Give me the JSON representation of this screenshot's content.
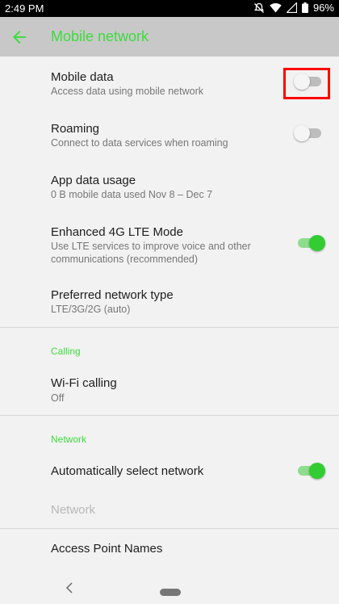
{
  "status_bar": {
    "time": "2:49 PM",
    "battery": "96%"
  },
  "appbar": {
    "title": "Mobile network"
  },
  "items": {
    "mobile_data": {
      "title": "Mobile data",
      "subtitle": "Access data using mobile network",
      "toggle": "off"
    },
    "roaming": {
      "title": "Roaming",
      "subtitle": "Connect to data services when roaming",
      "toggle": "off"
    },
    "app_data_usage": {
      "title": "App data usage",
      "subtitle": "0 B mobile data used Nov 8 – Dec 7"
    },
    "enhanced_lte": {
      "title": "Enhanced 4G LTE Mode",
      "subtitle_line1": "Use LTE services to improve voice and other",
      "subtitle_line2": "communications (recommended)",
      "toggle": "on"
    },
    "preferred_network": {
      "title": "Preferred network type",
      "subtitle": "LTE/3G/2G (auto)"
    }
  },
  "calling_section": {
    "header": "Calling",
    "wifi_calling": {
      "title": "Wi-Fi calling",
      "subtitle": "Off"
    }
  },
  "network_section": {
    "header": "Network",
    "auto_select": {
      "title": "Automatically select network",
      "toggle": "on"
    },
    "network": {
      "title": "Network"
    },
    "apn": {
      "title": "Access Point Names"
    }
  },
  "colors": {
    "accent": "#3ddc3d",
    "appbar": "#c8c8c8",
    "highlight": "#ff0000"
  }
}
